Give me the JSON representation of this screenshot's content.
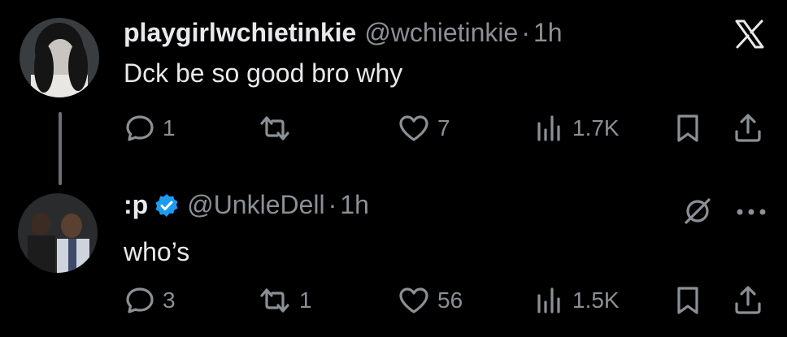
{
  "tweets": [
    {
      "name": "playgirlwchietinkie",
      "handle": "@wchietinkie",
      "separator": "·",
      "time": "1h",
      "text": "Dck be so good bro why",
      "reply_count": "1",
      "retweet_count": "",
      "like_count": "7",
      "view_count": "1.7K",
      "icons": [
        "reply-icon",
        "retweet-icon",
        "like-icon",
        "views-icon",
        "bookmark-icon",
        "share-icon"
      ]
    },
    {
      "name": ":p",
      "verified": true,
      "handle": "@UnkleDell",
      "separator": "·",
      "time": "1h",
      "text": "who’s",
      "reply_count": "3",
      "retweet_count": "1",
      "like_count": "56",
      "view_count": "1.5K",
      "icons": [
        "reply-icon",
        "retweet-icon",
        "like-icon",
        "views-icon",
        "bookmark-icon",
        "share-icon"
      ]
    }
  ],
  "top_right_icon": "x-logo-icon",
  "colors": {
    "background": "#000000",
    "primary_text": "#e7e9ea",
    "secondary_text": "#8b9096",
    "verified_badge": "#1d9bf0"
  }
}
